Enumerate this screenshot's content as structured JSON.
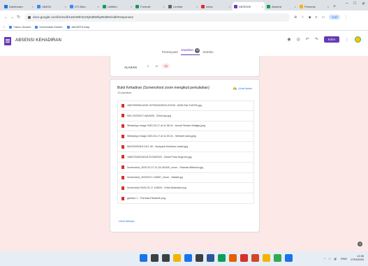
{
  "browser": {
    "tabs": [
      {
        "label": "Dashboard",
        "color": "#1a73e8",
        "active": false
      },
      {
        "label": "UBAYA",
        "color": "#4285f4",
        "active": false
      },
      {
        "label": "KTI Baru",
        "color": "#4285f4",
        "active": false
      },
      {
        "label": "Untitled",
        "color": "#0f9d58",
        "active": false
      },
      {
        "label": "Formulir",
        "color": "#0f9d58",
        "active": false
      },
      {
        "label": "Lembar",
        "color": "#5f6368",
        "active": false
      },
      {
        "label": "Inbox",
        "color": "#d93025",
        "active": false
      },
      {
        "label": "ABSENSI",
        "color": "#673ab7",
        "active": true
      },
      {
        "label": "Absensi",
        "color": "#0f9d58",
        "active": false
      },
      {
        "label": "Presensi",
        "color": "#f4b400",
        "active": false
      }
    ],
    "new_tab": "+",
    "window_controls": {
      "minimize": "–",
      "maximize": "□",
      "close": "✕"
    },
    "url": "docs.google.com/forms/d/1aSOWh4z23jXd8Wfq3NdMG/edit#responses",
    "back_icon": "←",
    "forward_icon": "→",
    "reload_icon": "↻",
    "profile_label": "Cari",
    "bookmarks": [
      "Yahoo Search",
      "Universitas Kristen",
      "JAKARTA Map"
    ]
  },
  "form": {
    "title": "ABSENSI KEHADIRAN",
    "star_icon": "☆",
    "send_label": "Kirim",
    "tabs": {
      "questions": "Pertanyaan",
      "responses": "Jawaban",
      "settings": "Setelan"
    },
    "response_count": "15"
  },
  "question_top": {
    "label": "ALASAN",
    "answers": [
      "2",
      "11",
      "15"
    ],
    "highlight": "15"
  },
  "question_main": {
    "title": "Bukti Kehadiran (Screenshoot zoom mengikuti perkuliahan)",
    "subtitle": "13 jawaban",
    "drive_link": "Lihat folder",
    "files": [
      "158729099014235 1970032020023-ZOOM - ADELINA YUDITA.jpg",
      "IMG-20200317-WA0026 - Dhea Ayu.jpg",
      "WhatsApp Image 2020-03-17 at 11.58.24 - Arnold Sinatra Widjaja.jpeg",
      "WhatsApp Image 2020-03-17 at 11.59.24 - Sefrianti Aulia.jpeg",
      "IMG20200318 1012 46 - Noviyanti Kristiana Lestari.jpg",
      "158372040416218 ZOOM2020 - Dandi Putra Nugroho.jpg",
      "Screenshot_2020-03-17-11-34-38-820_zoom - Yolanda Wibisono.jpg",
      "Screenshot_20200317-115557_Zoom - Natalie.jpg",
      "Screenshot 2020-03-17 115624 - Kristi Bulandari.png",
      "gambar 1 - Theresia Elizabeth.png"
    ],
    "more_link": "Lihat lainnya"
  },
  "help_icon": "?",
  "taskbar": {
    "apps": [
      {
        "name": "windows-start",
        "color": "#1a73e8"
      },
      {
        "name": "search",
        "color": "#3c4043"
      },
      {
        "name": "task-view",
        "color": "#3c4043"
      },
      {
        "name": "file-explorer",
        "color": "#f4b400"
      },
      {
        "name": "mail",
        "color": "#1a73e8"
      },
      {
        "name": "store",
        "color": "#3c4043"
      },
      {
        "name": "word",
        "color": "#2b579a"
      },
      {
        "name": "chrome",
        "color": "#0f9d58"
      },
      {
        "name": "firefox",
        "color": "#e66000"
      },
      {
        "name": "opera",
        "color": "#d93025"
      },
      {
        "name": "powerpoint",
        "color": "#d24726"
      },
      {
        "name": "folder",
        "color": "#f4b400"
      },
      {
        "name": "maps",
        "color": "#34a853"
      },
      {
        "name": "photos",
        "color": "#1a73e8"
      }
    ],
    "tray": [
      "^",
      "□",
      "🔊",
      "ENG"
    ],
    "time": "12.06",
    "date": "17/03/2020"
  }
}
